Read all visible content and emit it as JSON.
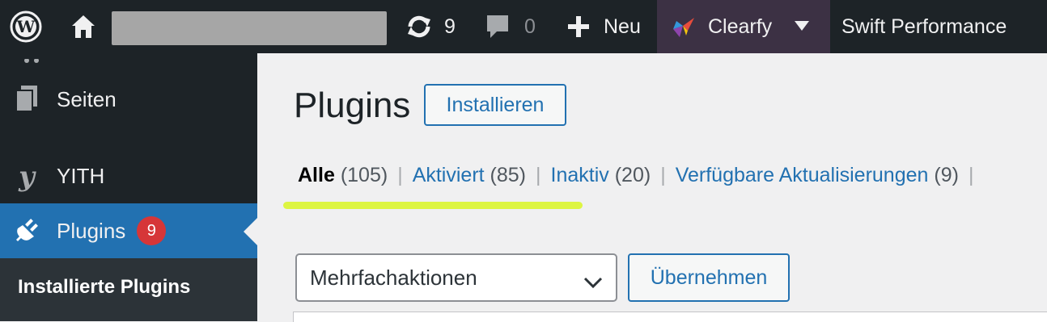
{
  "adminbar": {
    "updates_count": "9",
    "comments_count": "0",
    "new_label": "Neu",
    "clearfy_label": "Clearfy",
    "swift_label": "Swift Performance"
  },
  "sidebar": {
    "items": [
      {
        "label": "Seiten",
        "icon": "pages-icon"
      },
      {
        "label": "YITH",
        "icon": "yith-icon"
      },
      {
        "label": "Plugins",
        "icon": "plugins-icon",
        "badge": "9"
      }
    ],
    "submenu": {
      "current_label": "Installierte Plugins"
    }
  },
  "main": {
    "title": "Plugins",
    "add_new_label": "Installieren",
    "filters": {
      "all": {
        "label": "Alle",
        "count": "(105)"
      },
      "active": {
        "label": "Aktiviert",
        "count": "(85)"
      },
      "inactive": {
        "label": "Inaktiv",
        "count": "(20)"
      },
      "updates": {
        "label": "Verfügbare Aktualisierungen",
        "count": "(9)"
      },
      "separator": "|"
    },
    "bulk_actions": {
      "selected": "Mehrfachaktionen"
    },
    "apply_label": "Übernehmen"
  },
  "colors": {
    "adminbar_bg": "#1d2327",
    "accent": "#2271b1",
    "badge": "#d63638",
    "highlight": "#ddf542",
    "clearfy_bg": "#3c3144"
  }
}
